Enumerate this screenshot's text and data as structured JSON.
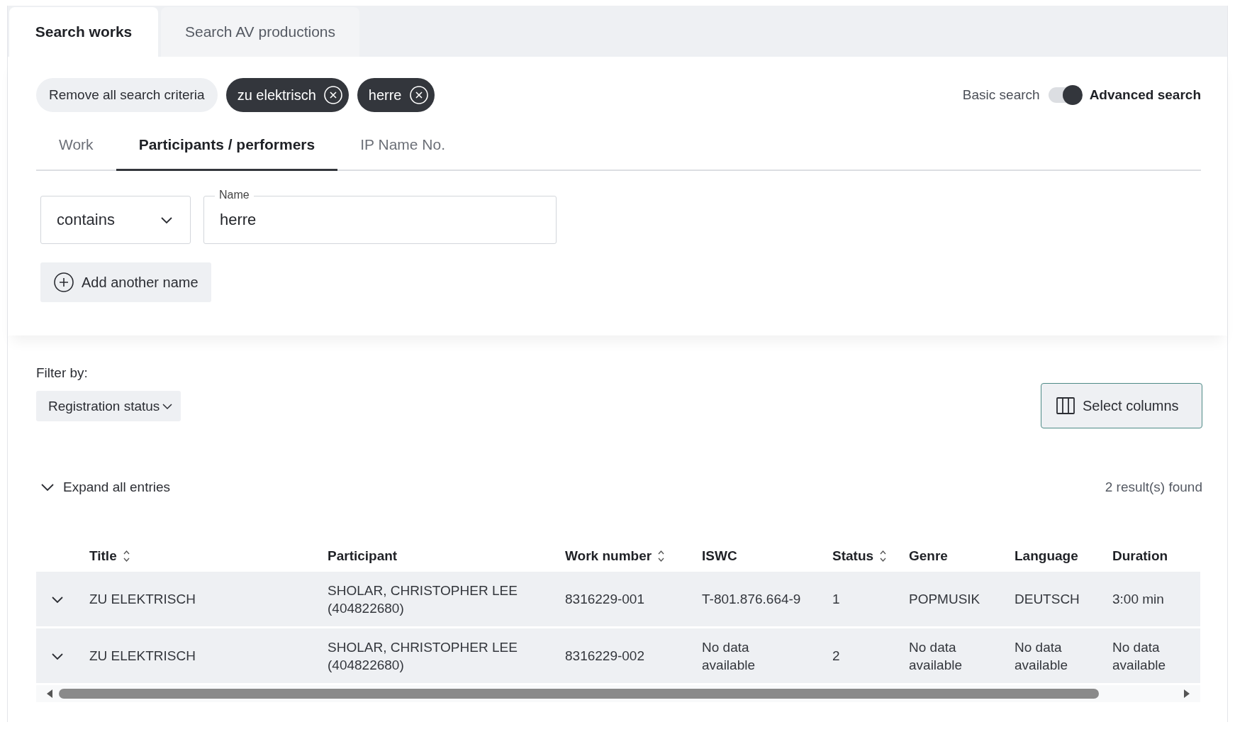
{
  "page_tabs": [
    {
      "label": "Search works",
      "selected": true
    },
    {
      "label": "Search AV productions",
      "selected": false
    }
  ],
  "criteria": {
    "remove_all": "Remove all search criteria",
    "chips": [
      "zu elektrisch",
      "herre"
    ]
  },
  "search_mode": {
    "basic_label": "Basic search",
    "advanced_label": "Advanced search",
    "advanced": true
  },
  "sub_tabs": [
    {
      "label": "Work",
      "selected": false
    },
    {
      "label": "Participants / performers",
      "selected": true
    },
    {
      "label": "IP Name No.",
      "selected": false
    }
  ],
  "match_select": {
    "value": "contains"
  },
  "name_field": {
    "label": "Name",
    "value": "herre"
  },
  "add_button": "Add another name",
  "filter": {
    "label": "Filter by:",
    "dropdown": "Registration status"
  },
  "select_columns": "Select columns",
  "expand_all": "Expand all entries",
  "result_count": "2 result(s) found",
  "table": {
    "columns": [
      {
        "label": "Title",
        "sortable": true
      },
      {
        "label": "Participant",
        "sortable": false
      },
      {
        "label": "Work number",
        "sortable": true
      },
      {
        "label": "ISWC",
        "sortable": false
      },
      {
        "label": "Status",
        "sortable": true
      },
      {
        "label": "Genre",
        "sortable": false
      },
      {
        "label": "Language",
        "sortable": false
      },
      {
        "label": "Duration",
        "sortable": false
      }
    ],
    "rows": [
      {
        "expanded": false,
        "cells": [
          "ZU ELEKTRISCH",
          "SHOLAR, CHRISTOPHER LEE (404822680)",
          "8316229-001",
          "T-801.876.664-9",
          "1",
          "POPMUSIK",
          "DEUTSCH",
          "3:00 min"
        ]
      },
      {
        "expanded": false,
        "cells": [
          "ZU ELEKTRISCH",
          "SHOLAR, CHRISTOPHER LEE (404822680)",
          "8316229-002",
          "No data available",
          "2",
          "No data available",
          "No data available",
          "No data available"
        ]
      }
    ]
  }
}
